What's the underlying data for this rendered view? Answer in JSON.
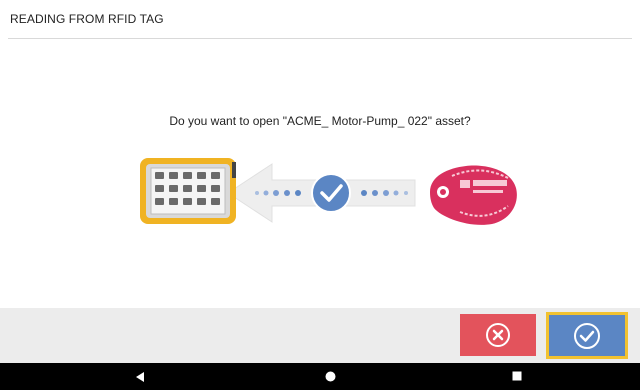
{
  "header": {
    "title": "READING FROM RFID TAG"
  },
  "dialog": {
    "prompt": "Do you want to open \"ACME_ Motor-Pump_ 022\" asset?"
  },
  "illustration": {
    "device": "handheld-device-icon",
    "arrow": "arrow-left-icon",
    "status": "check-circle-icon",
    "tag": "rfid-tag-icon",
    "colors": {
      "device": "#f0b323",
      "check": "#5b86c4",
      "tag": "#d9305e"
    }
  },
  "footer": {
    "cancel": {
      "icon": "close-circle-icon",
      "color": "#e3535c"
    },
    "confirm": {
      "icon": "check-circle-icon",
      "color": "#5b86c4",
      "highlight": "#f2c230"
    }
  },
  "navbar": {
    "back": "back-triangle-icon",
    "home": "home-circle-icon",
    "recents": "recents-square-icon"
  }
}
